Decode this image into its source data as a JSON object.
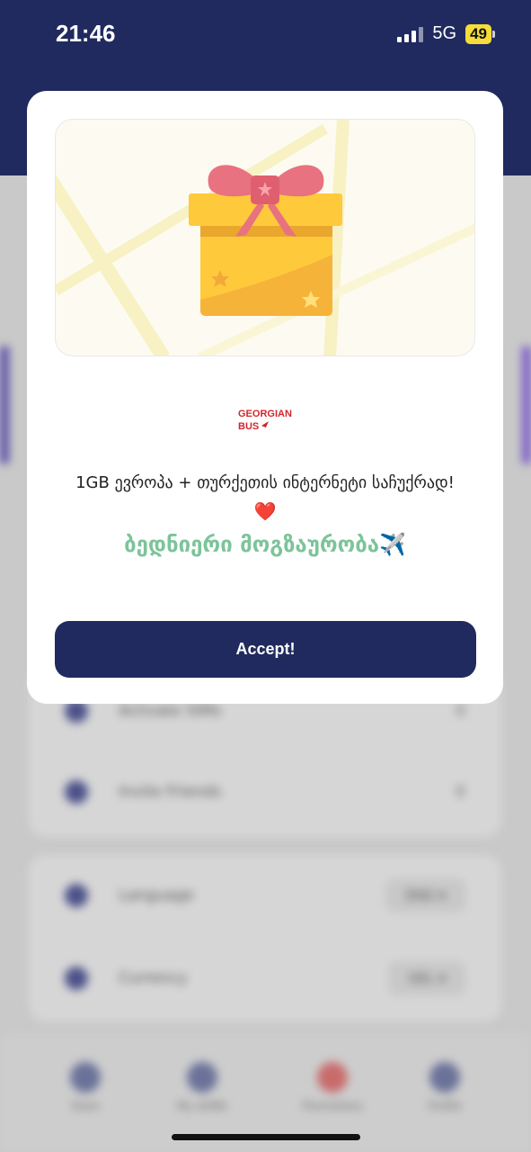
{
  "status_bar": {
    "time": "21:46",
    "network": "5G",
    "battery": "49"
  },
  "background": {
    "rows": [
      {
        "label": "Activate SIMs",
        "end": "0"
      },
      {
        "label": "Invite Friends",
        "end": "0"
      }
    ],
    "settings": [
      {
        "label": "Language",
        "value": "ENG ▾"
      },
      {
        "label": "Currency",
        "value": "GEL ▾"
      }
    ],
    "nav": [
      "Store",
      "My eSIMs",
      "Promotions",
      "Profile"
    ]
  },
  "modal": {
    "brand_line1": "GEORGIAN",
    "brand_line2": "BUS",
    "promo_text": "1GB ევროპა + თურქეთის ინტერნეტი საჩუქრად!",
    "heart": "❤️",
    "wish_text": "ბედნიერი მოგზაურობა✈️",
    "accept_label": "Accept!"
  },
  "colors": {
    "header_bg": "#212a5e",
    "button_bg": "#212a5e",
    "wish_text": "#7cc49a",
    "brand_red": "#d4252a",
    "gift_box": "#ffc93c",
    "ribbon": "#e8727f"
  }
}
